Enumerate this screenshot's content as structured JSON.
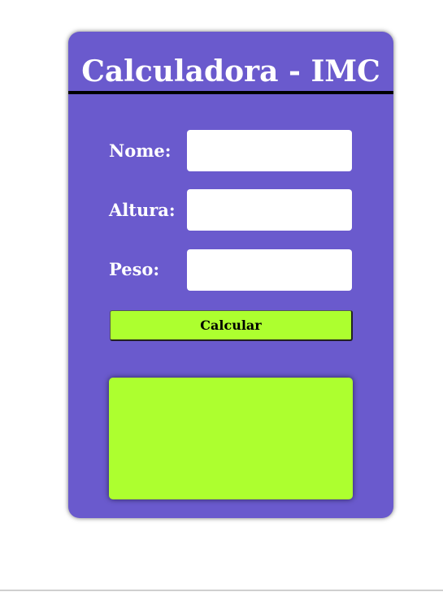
{
  "app": {
    "title": "Calculadora - IMC"
  },
  "form": {
    "fields": [
      {
        "label": "Nome:",
        "value": "",
        "placeholder": ""
      },
      {
        "label": "Altura:",
        "value": "",
        "placeholder": ""
      },
      {
        "label": "Peso:",
        "value": "",
        "placeholder": ""
      }
    ],
    "submit_label": "Calcular"
  },
  "result": {
    "text": ""
  },
  "colors": {
    "card_background": "#6a5acd",
    "accent_green": "#adff2f",
    "title_rule": "#000000",
    "label_text": "#ffffff"
  }
}
